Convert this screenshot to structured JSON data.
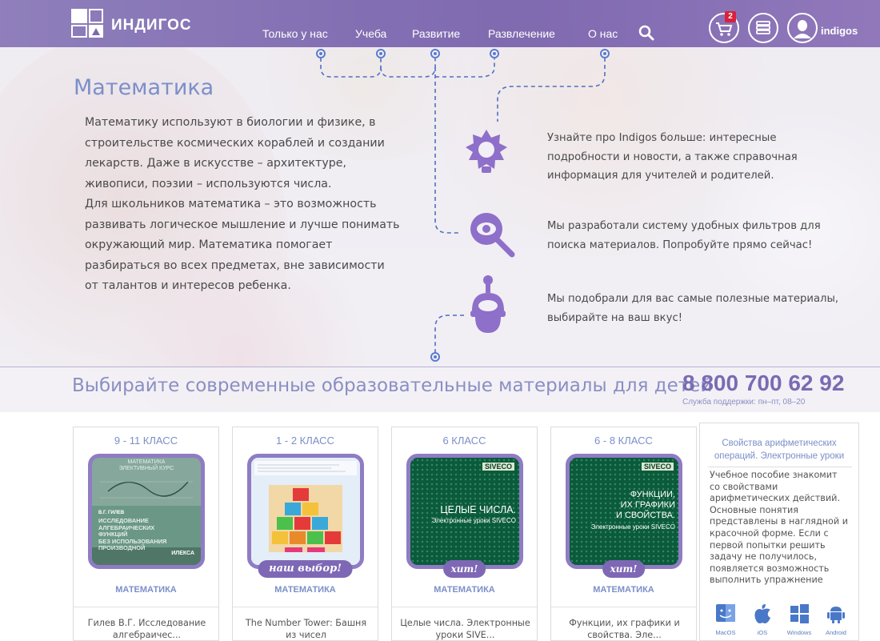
{
  "header": {
    "logo_text": "ИНДИГОС",
    "nav": [
      {
        "label": "Только у нас"
      },
      {
        "label": "Учеба"
      },
      {
        "label": "Развитие"
      },
      {
        "label": "Развлечение"
      },
      {
        "label": "О нас"
      }
    ],
    "cart_count": "2",
    "username": "indigos"
  },
  "hero": {
    "title": "Математика",
    "intro": [
      "Математику используют в биологии и физике, в",
      "строительстве космических кораблей и создании",
      "лекарств. Даже в искусстве – архитектуре,",
      "живописи, поэзии – используются числа.",
      "Для школьников математика – это возможность",
      "развивать логическое мышление и лучше понимать",
      "окружающий мир. Математика помогает",
      "разбираться во всех предметах, вне зависимости",
      "от талантов и интересов ребенка."
    ],
    "features": [
      {
        "icon": "lightbulb-icon",
        "lines": [
          "Узнайте про Indigos больше: интересные",
          "подробности и новости, а также справочная",
          "информация для учителей и родителей."
        ]
      },
      {
        "icon": "magnifier-eye-icon",
        "lines": [
          "Мы разработали систему удобных фильтров для",
          "поиска материалов. Попробуйте прямо сейчас!"
        ]
      },
      {
        "icon": "robot-icon",
        "lines": [
          "Мы подобрали для вас самые полезные материалы,",
          "выбирайте на ваш вкус!"
        ]
      }
    ]
  },
  "promo": {
    "text": "Выбирайте современные образовательные материалы для детей",
    "phone": "8 800 700 62 92",
    "support": "Служба поддержки: пн–пт, 08–20"
  },
  "cards": [
    {
      "grade": "9 - 11 КЛАСС",
      "subject": "МАТЕМАТИКА",
      "desc1": "Гилев В.Г. Исследование",
      "desc2": "алгебраичес...",
      "book_series": "МАТЕМАТИКА",
      "book_series2": "ЭЛЕКТИВНЫЙ КУРС",
      "book_author": "В.Г. ГИЛЕВ",
      "book_title": [
        "ИССЛЕДОВАНИЕ",
        "АЛГЕБРАИЧЕСКИХ",
        "ФУНКЦИЙ",
        "БЕЗ ИСПОЛЬЗОВАНИЯ",
        "ПРОИЗВОДНОЙ"
      ],
      "book_publisher": "ИЛЕКСА"
    },
    {
      "grade": "1 - 2 КЛАСС",
      "subject": "МАТЕМАТИКА",
      "desc1": "The Number Tower: Башня",
      "desc2": "из чисел",
      "ribbon": "наш выбор!"
    },
    {
      "grade": "6 КЛАСС",
      "subject": "МАТЕМАТИКА",
      "desc1": "Целые числа. Электронные",
      "desc2": "уроки SIVE...",
      "ribbon": "хит!",
      "cover_title": "ЦЕЛЫЕ ЧИСЛА.",
      "cover_sub": "Электронные уроки SIVECO",
      "brand": "SIVECO"
    },
    {
      "grade": "6 - 8 КЛАСС",
      "subject": "МАТЕМАТИКА",
      "desc1": "Функции, их графики и",
      "desc2": "свойства. Эле...",
      "ribbon": "хит!",
      "cover_title": [
        "ФУНКЦИИ,",
        "ИХ ГРАФИКИ",
        "И СВОЙСТВА."
      ],
      "cover_sub": "Электронные уроки SIVECO",
      "brand": "SIVECO"
    }
  ],
  "side": {
    "title1": "Свойства арифметических",
    "title2": "операций. Электронные уроки",
    "text": [
      "Учебное пособие знакомит",
      "со свойствами",
      "арифметических действий.",
      "Основные понятия",
      "представлены в наглядной и",
      "красочной форме. Если с",
      "первой попытки решить",
      "задачу не получилось,",
      "появляется возможность",
      "выполнить упражнение"
    ],
    "platforms": [
      "MacOS",
      "iOS",
      "Windows",
      "Android"
    ]
  },
  "colors": {
    "accent": "#7d69b0",
    "link": "#7b8fc9",
    "badge": "#d8223b"
  }
}
